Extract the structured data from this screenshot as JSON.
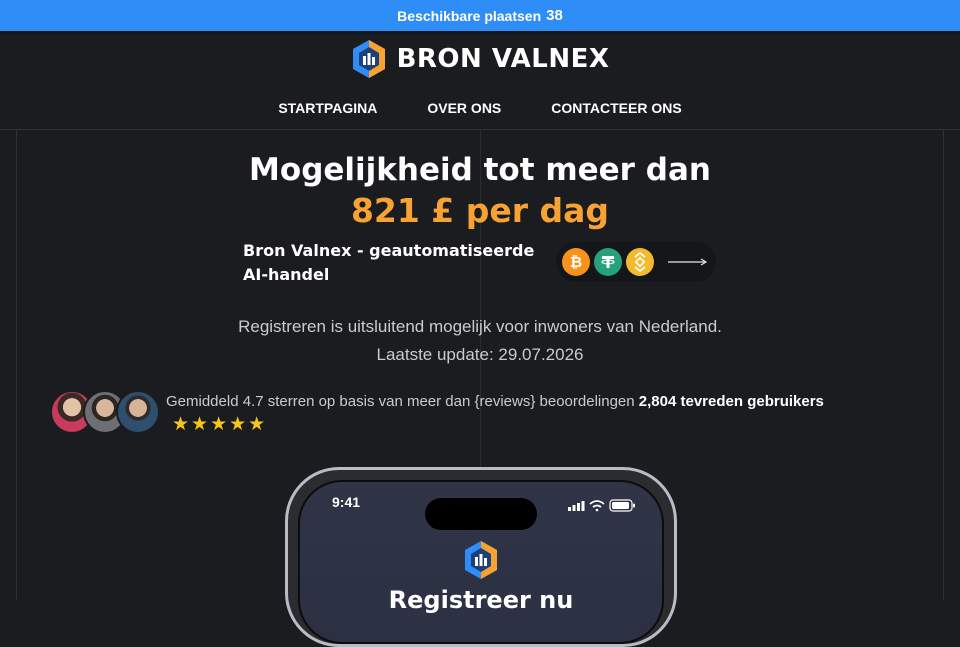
{
  "topbar": {
    "label": "Beschikbare plaatsen",
    "count": "38"
  },
  "brand": {
    "name": "BRON VALNEX",
    "accent": "#2f8df7",
    "orange": "#f7a232"
  },
  "nav": {
    "items": [
      {
        "label": "STARTPAGINA"
      },
      {
        "label": "OVER ONS"
      },
      {
        "label": "CONTACTEER ONS"
      }
    ]
  },
  "hero": {
    "title": "Mogelijkheid tot meer dan",
    "amount": "821 £ per dag",
    "subtitle": "Bron Valnex - geautomatiseerde AI-handel"
  },
  "crypto": {
    "icons": [
      "bitcoin-icon",
      "tether-icon",
      "binance-icon",
      "arrow-right-icon"
    ]
  },
  "info": {
    "notice": "Registreren is uitsluitend mogelijk voor inwoners van Nederland.",
    "update": "Laatste update: 29.07.2026"
  },
  "reviews": {
    "text": "Gemiddeld 4.7 sterren op basis van meer dan {reviews} beoordelingen",
    "users": "2,804 tevreden gebruikers",
    "stars": "★★★★★",
    "rating_stars": 5
  },
  "phone": {
    "time": "9:41",
    "heading": "Registreer nu"
  }
}
